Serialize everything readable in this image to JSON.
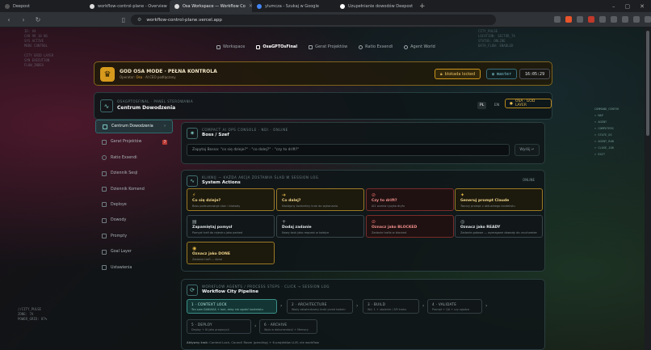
{
  "browser": {
    "tabs": [
      {
        "title": "Deepost",
        "active": false
      },
      {
        "title": "workflow-control-plane - Overview",
        "active": false
      },
      {
        "title": "Osa Workspace — Workflow Co",
        "active": true
      },
      {
        "title": "ylumcza - Szukaj w Google",
        "active": false
      },
      {
        "title": "Uzupełnianie dowodów Deepost",
        "active": false
      }
    ],
    "new_tab": "+",
    "url": "workflow-control-plane.vercel.app"
  },
  "bg_left_top": "ID: V4\nCAR 99 10 NG\nSYS ACTIVE\nMODE CONTROL\n\nCITY GRID LAYER\nSYN EXECUTION\nFLOW_INDEX",
  "bg_right_top": "CITY_PULSE\nLOCATION: SECTOR_7A\nSTATUS: ONLINE\nDATA_FLOW: ENABLED",
  "bg_left_bottom": "//CITY_PULSE\nZONE: 7A\nPOWER_GRID: 87%",
  "minimenu": [
    "COMMAND_CENTER",
    "> MAP",
    "> AGENT",
    "> COMPUTERS",
    "> STATE_OS",
    "> AGENT_RUN",
    "> CLOSE_JOB",
    "> EXIT"
  ],
  "topnav": [
    {
      "label": "Workspace",
      "active": false
    },
    {
      "label": "OsaGPTOsFinal",
      "active": true
    },
    {
      "label": "Gerat Projektów",
      "active": false
    },
    {
      "label": "Ratio Exsendi",
      "active": false
    },
    {
      "label": "Agent World",
      "active": false
    }
  ],
  "god": {
    "crown": "♛",
    "title": "GOD OSA MODE · PEŁNA KONTROLA",
    "sub_prefix": "Operator:",
    "sub_name": "Osa",
    "sub_suffix": "· AI CEO podłączony",
    "lock_label": "blokada locked",
    "branch_label": "master",
    "time": "16:05:29"
  },
  "command": {
    "eyebrow": "OSAGPTOSFINAL · PANEL STEROWANIA",
    "title": "Centrum Dowodzenia",
    "lang_pl": "PL",
    "lang_en": "EN",
    "layer_label": "OSA · GOD LAYER"
  },
  "sidebar": [
    {
      "label": "Centrum Dowodzenia",
      "active": true
    },
    {
      "label": "Gerat Projektów",
      "badge": "7"
    },
    {
      "label": "Ratio Exsendi"
    },
    {
      "label": "Dziennik Sesji"
    },
    {
      "label": "Dziennik Komend"
    },
    {
      "label": "Deploye"
    },
    {
      "label": "Dowody"
    },
    {
      "label": "Prompty"
    },
    {
      "label": "Goal Layer"
    },
    {
      "label": "Ustawienia"
    }
  ],
  "console": {
    "eyebrow": "COMPACT AI OPS CONSOLE · NDI · ONLINE",
    "title": "Boss / Szef",
    "placeholder": "Zapytaj Bossa: \"co się dzieje?\" · \"co dalej?\" · \"czy to drift?\"",
    "send_label": "Wyślij ↵"
  },
  "actions": {
    "eyebrow": "KLIKNIJ — KAŻDA AKCJA ZOSTAWIA ŚLAD W SESSION LOG",
    "title": "System Actions",
    "status": "ONLINE",
    "items": [
      {
        "icon": "⚡",
        "title": "Co się dzieje?",
        "desc": "Boss podsumowuje stan i blokady",
        "style": "gold"
      },
      {
        "icon": "➔",
        "title": "Co dalej?",
        "desc": "Następny konkretny krok do wykonania",
        "style": "gold"
      },
      {
        "icon": "⊘",
        "title": "Czy to drift?",
        "desc": "AI1 ocenia ryzyko dryfu",
        "style": "red"
      },
      {
        "icon": "✦",
        "title": "Generuj prompt Claude",
        "desc": "Tworzy prompt z aktualnego kontekstu",
        "style": "gold"
      },
      {
        "icon": "▤",
        "title": "Zapamiętaj pomysł",
        "desc": "Pomysł trafi do rejestru jako parked",
        "style": "grey"
      },
      {
        "icon": "+",
        "title": "Dodaj zadanie",
        "desc": "Nowy task jako request w kolejce",
        "style": "grey"
      },
      {
        "icon": "⊘",
        "title": "Oznacz jako BLOCKED",
        "desc": "Zadanie trafia w blocked",
        "style": "red"
      },
      {
        "icon": "◎",
        "title": "Oznacz jako READY",
        "desc": "Zadanie gotowe — wymagane dowody do uruchomienia",
        "style": "grey"
      },
      {
        "icon": "◉",
        "title": "Oznacz jako DONE",
        "desc": "Zadanie trafi — done",
        "style": "gold"
      }
    ]
  },
  "pipeline": {
    "eyebrow": "WORKFLOW AGENTS / PROCESS STEPS · CLICK → SESSION LOG",
    "title": "Workflow City Pipeline",
    "steps": [
      {
        "title": "1 · CONTEXT LOCK",
        "desc": "Ten sam DANIAGA + lock, żeby nie zgubić kontekstu",
        "active": true
      },
      {
        "title": "2 · ARCHITECTURE",
        "desc": "Wady zatwierdzamy kroki przed kodem"
      },
      {
        "title": "3 · BUILD",
        "desc": "Wd. 1 + ułożenie / API kroku"
      },
      {
        "title": "4 · VALIDATE",
        "desc": "Prompt + QA + czy zgadza"
      },
      {
        "title": "5 · DEPLOY",
        "desc": "Deploy + AI jako propozycji"
      },
      {
        "title": "6 · ARCHIVE",
        "desc": "Wpis w dokumentacji + Memory"
      }
    ],
    "agents_label": "Aktywny krok:",
    "agents_text": "Context Lock, Council Room (pending) + 6 projektów LLM, nie workflow"
  }
}
